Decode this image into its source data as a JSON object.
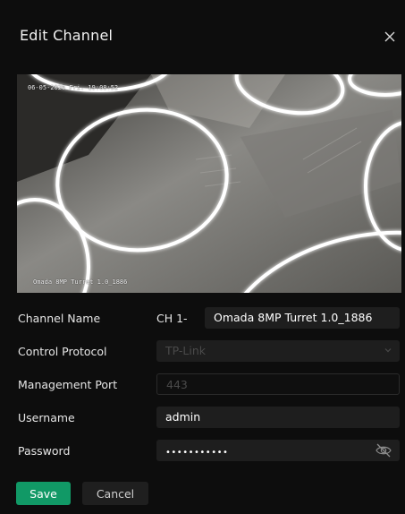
{
  "dialog": {
    "title": "Edit Channel"
  },
  "preview": {
    "osd_time": "06-05-2026 Fri. 19:08:52",
    "osd_name": "Omada 8MP Turret 1.0_1886"
  },
  "form": {
    "channel_name": {
      "label": "Channel Name",
      "prefix": "CH 1-",
      "value": "Omada 8MP Turret 1.0_1886"
    },
    "control_protocol": {
      "label": "Control Protocol",
      "value": "TP-Link"
    },
    "management_port": {
      "label": "Management Port",
      "placeholder": "443"
    },
    "username": {
      "label": "Username",
      "value": "admin"
    },
    "password": {
      "label": "Password",
      "value": "•••••••••••"
    }
  },
  "buttons": {
    "save": "Save",
    "cancel": "Cancel"
  },
  "colors": {
    "accent": "#119966",
    "background": "#0d0d0d",
    "field": "#1e1e1e"
  },
  "icons": {
    "close": "close-icon",
    "chevron": "chevron-down-icon",
    "visibility": "eye-off-icon"
  }
}
